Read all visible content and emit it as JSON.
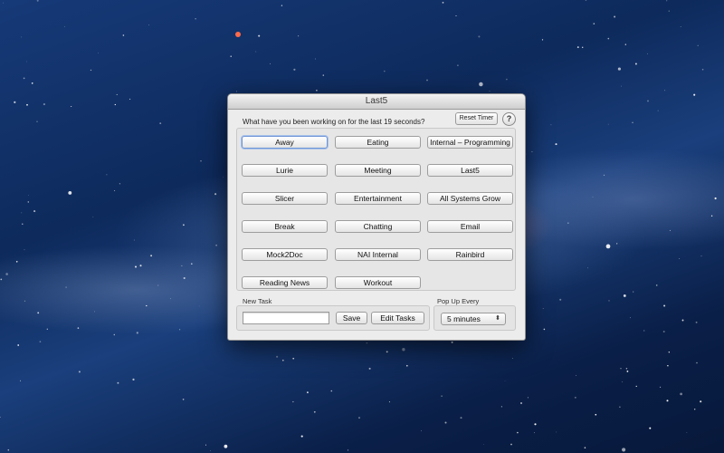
{
  "window": {
    "title": "Last5",
    "prompt": "What have you been working on for the last 19 seconds?",
    "reset_timer_label": "Reset Timer",
    "help_label": "?"
  },
  "tasks": [
    "Away",
    "Eating",
    "Internal – Programming",
    "Lurie",
    "Meeting",
    "Last5",
    "Slicer",
    "Entertainment",
    "All Systems Grow",
    "Break",
    "Chatting",
    "Email",
    "Mock2Doc",
    "NAI Internal",
    "Rainbird",
    "Reading News",
    "Workout"
  ],
  "new_task": {
    "label": "New Task",
    "value": "",
    "save_label": "Save",
    "edit_label": "Edit Tasks"
  },
  "popup_every": {
    "label": "Pop Up Every",
    "selected": "5 minutes",
    "arrows": "⬍"
  }
}
